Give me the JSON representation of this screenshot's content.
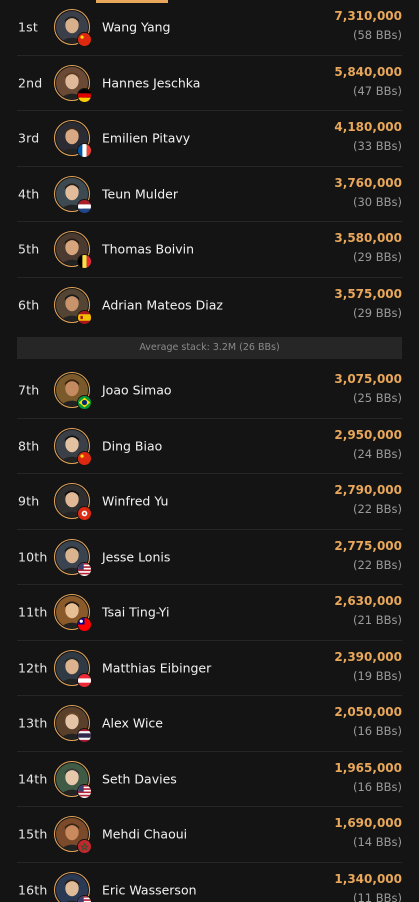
{
  "colors": {
    "accent": "#e8a75a",
    "background": "#141414",
    "muted": "#9a9a9a"
  },
  "average_stack": "Average stack: 3.2M (26 BBs)",
  "players": [
    {
      "rank": "1st",
      "name": "Wang Yang",
      "chips": "7,310,000",
      "bbs": "(58 BBs)",
      "flag": "china-flag-icon"
    },
    {
      "rank": "2nd",
      "name": "Hannes Jeschka",
      "chips": "5,840,000",
      "bbs": "(47 BBs)",
      "flag": "germany-flag-icon"
    },
    {
      "rank": "3rd",
      "name": "Emilien Pitavy",
      "chips": "4,180,000",
      "bbs": "(33 BBs)",
      "flag": "france-flag-icon"
    },
    {
      "rank": "4th",
      "name": "Teun Mulder",
      "chips": "3,760,000",
      "bbs": "(30 BBs)",
      "flag": "netherlands-flag-icon"
    },
    {
      "rank": "5th",
      "name": "Thomas Boivin",
      "chips": "3,580,000",
      "bbs": "(29 BBs)",
      "flag": "belgium-flag-icon"
    },
    {
      "rank": "6th",
      "name": "Adrian Mateos Diaz",
      "chips": "3,575,000",
      "bbs": "(29 BBs)",
      "flag": "spain-flag-icon"
    },
    {
      "rank": "7th",
      "name": "Joao Simao",
      "chips": "3,075,000",
      "bbs": "(25 BBs)",
      "flag": "brazil-flag-icon"
    },
    {
      "rank": "8th",
      "name": "Ding Biao",
      "chips": "2,950,000",
      "bbs": "(24 BBs)",
      "flag": "china-flag-icon"
    },
    {
      "rank": "9th",
      "name": "Winfred Yu",
      "chips": "2,790,000",
      "bbs": "(22 BBs)",
      "flag": "hong-kong-flag-icon"
    },
    {
      "rank": "10th",
      "name": "Jesse Lonis",
      "chips": "2,775,000",
      "bbs": "(22 BBs)",
      "flag": "usa-flag-icon"
    },
    {
      "rank": "11th",
      "name": "Tsai Ting-Yi",
      "chips": "2,630,000",
      "bbs": "(21 BBs)",
      "flag": "taiwan-flag-icon"
    },
    {
      "rank": "12th",
      "name": "Matthias Eibinger",
      "chips": "2,390,000",
      "bbs": "(19 BBs)",
      "flag": "austria-flag-icon"
    },
    {
      "rank": "13th",
      "name": "Alex Wice",
      "chips": "2,050,000",
      "bbs": "(16 BBs)",
      "flag": "thailand-flag-icon"
    },
    {
      "rank": "14th",
      "name": "Seth Davies",
      "chips": "1,965,000",
      "bbs": "(16 BBs)",
      "flag": "usa-flag-icon"
    },
    {
      "rank": "15th",
      "name": "Mehdi Chaoui",
      "chips": "1,690,000",
      "bbs": "(14 BBs)",
      "flag": "morocco-flag-icon"
    },
    {
      "rank": "16th",
      "name": "Eric Wasserson",
      "chips": "1,340,000",
      "bbs": "(11 BBs)",
      "flag": "usa-flag-icon"
    }
  ]
}
